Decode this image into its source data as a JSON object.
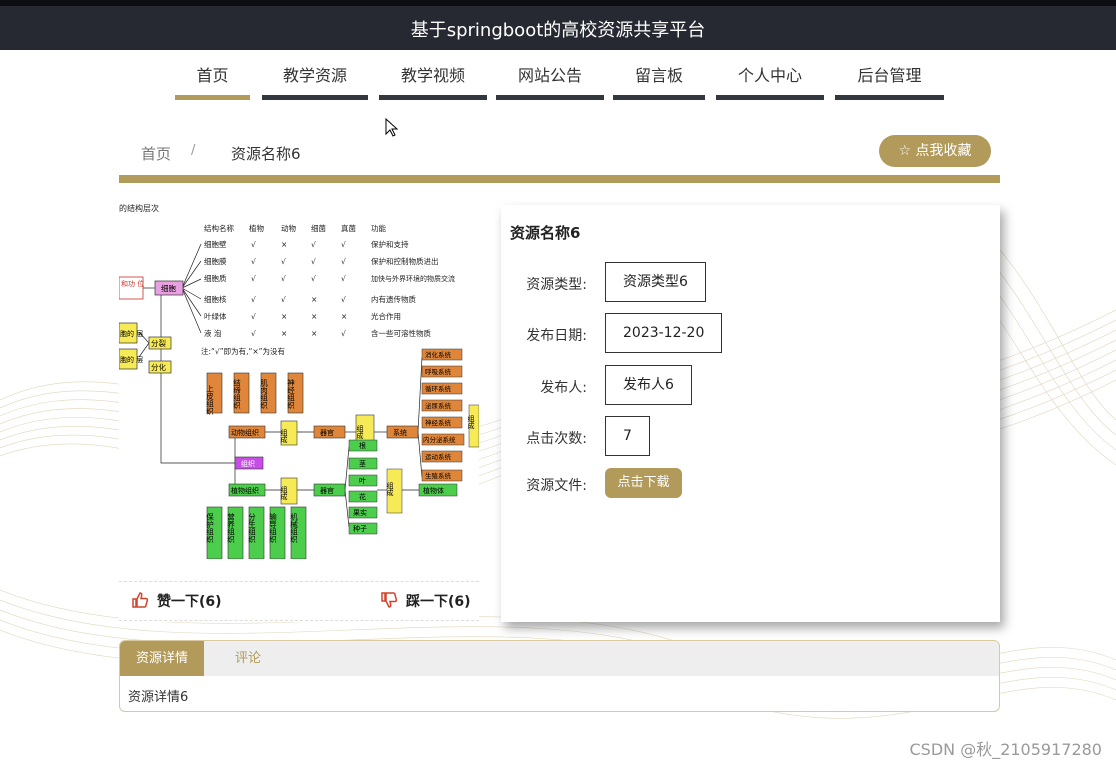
{
  "header": {
    "title": "基于springboot的高校资源共享平台"
  },
  "nav": {
    "items": [
      {
        "label": "首页",
        "active": true
      },
      {
        "label": "教学资源"
      },
      {
        "label": "教学视频"
      },
      {
        "label": "网站公告"
      },
      {
        "label": "留言板"
      },
      {
        "label": "个人中心"
      },
      {
        "label": "后台管理"
      }
    ]
  },
  "breadcrumb": {
    "home": "首页",
    "separator": "/",
    "current": "资源名称6"
  },
  "favorite_button": "☆ 点我收藏",
  "resource": {
    "title": "资源名称6",
    "fields": [
      {
        "label": "资源类型:",
        "value": "资源类型6"
      },
      {
        "label": "发布日期:",
        "value": "2023-12-20"
      },
      {
        "label": "发布人:",
        "value": "发布人6"
      },
      {
        "label": "点击次数:",
        "value": "7"
      }
    ],
    "file_label": "资源文件:",
    "download_button": "点击下载"
  },
  "votes": {
    "up": "赞一下(6)",
    "down": "踩一下(6)"
  },
  "tabs": [
    {
      "label": "资源详情",
      "active": true
    },
    {
      "label": "评论"
    }
  ],
  "detail_text": "资源详情6",
  "diagram": {
    "caption": "的结构层次",
    "table": {
      "headers": [
        "结构名称",
        "植物",
        "动物",
        "细菌",
        "真菌",
        "功能"
      ],
      "rows": [
        [
          "细胞壁",
          "√",
          "×",
          "√",
          "√",
          "保护和支持"
        ],
        [
          "细胞膜",
          "√",
          "√",
          "√",
          "√",
          "保护和控制物质进出"
        ],
        [
          "细胞质",
          "√",
          "√",
          "√",
          "√",
          "加快与外界环境的物质交流"
        ],
        [
          "细胞核",
          "√",
          "√",
          "×",
          "√",
          "内有遗传物质"
        ],
        [
          "叶绿体",
          "√",
          "×",
          "×",
          "×",
          "光合作用"
        ],
        [
          "液 泡",
          "√",
          "×",
          "×",
          "√",
          "含一些可溶性物质"
        ]
      ],
      "note": "注:“√”即为有,“×”为没有"
    },
    "nodes": {
      "left_top": "和功\n位",
      "left_a": "胞的\n层",
      "left_b": "胞的\n层",
      "cell": "细胞",
      "divide": "分裂",
      "differentiate": "分化",
      "animal_tissues": [
        "上皮组织",
        "结缔组织",
        "肌肉组织",
        "神经组织"
      ],
      "animal_tissue": "动物组织",
      "compose": "组成",
      "organ": "器官",
      "system": "系统",
      "systems": [
        "消化系统",
        "呼吸系统",
        "循环系统",
        "泌尿系统",
        "神经系统",
        "内分泌系统",
        "运动系统",
        "生殖系统"
      ],
      "right_edge": "组成",
      "tissue": "组织",
      "plant_tissue": "植物组织",
      "plant_tissues": [
        "保护组织",
        "营养组织",
        "分生组织",
        "输导组织",
        "机械组织"
      ],
      "plant_organs": [
        "根",
        "茎",
        "叶",
        "花",
        "果实",
        "种子"
      ],
      "plant_body": "植物体"
    }
  },
  "watermark": "CSDN @秋_2105917280",
  "colors": {
    "accent": "#b19a5a",
    "topbar": "#262932",
    "orange": "#e0863a",
    "green": "#4ccd4c",
    "yellow": "#f7ea57",
    "pink": "#e8a0e0",
    "magenta": "#c84ce8"
  }
}
